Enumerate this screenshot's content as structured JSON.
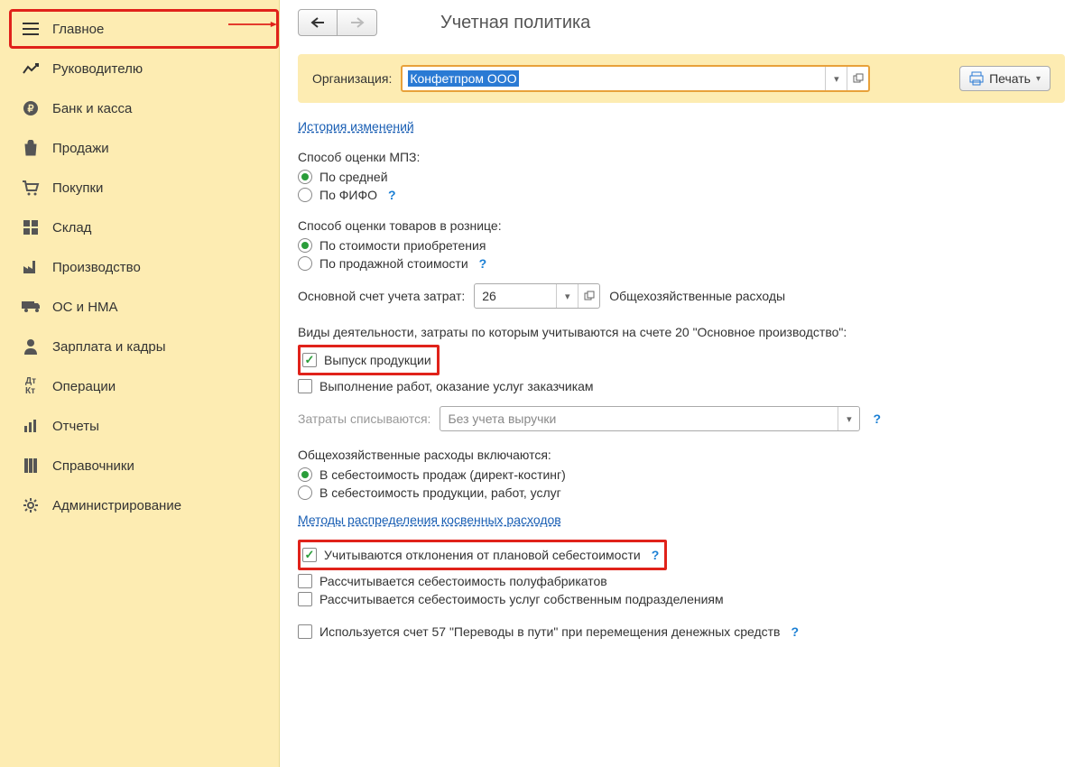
{
  "sidebar": {
    "items": [
      {
        "label": "Главное"
      },
      {
        "label": "Руководителю"
      },
      {
        "label": "Банк и касса"
      },
      {
        "label": "Продажи"
      },
      {
        "label": "Покупки"
      },
      {
        "label": "Склад"
      },
      {
        "label": "Производство"
      },
      {
        "label": "ОС и НМА"
      },
      {
        "label": "Зарплата и кадры"
      },
      {
        "label": "Операции"
      },
      {
        "label": "Отчеты"
      },
      {
        "label": "Справочники"
      },
      {
        "label": "Администрирование"
      }
    ]
  },
  "header": {
    "title": "Учетная политика",
    "print_label": "Печать"
  },
  "org": {
    "label": "Организация:",
    "value": "Конфетпром ООО"
  },
  "history_link": "История изменений",
  "mpz": {
    "label": "Способ оценки МПЗ:",
    "opt1": "По средней",
    "opt2": "По ФИФО"
  },
  "retail": {
    "label": "Способ оценки товаров в рознице:",
    "opt1": "По стоимости приобретения",
    "opt2": "По продажной стоимости"
  },
  "cost_account": {
    "label": "Основной счет учета затрат:",
    "value": "26",
    "hint": "Общехозяйственные расходы"
  },
  "activity": {
    "label": "Виды деятельности, затраты по которым учитываются на счете 20 \"Основное производство\":",
    "chk1": "Выпуск продукции",
    "chk2": "Выполнение работ, оказание услуг заказчикам"
  },
  "writeoff": {
    "label": "Затраты списываются:",
    "value": "Без учета выручки"
  },
  "overhead": {
    "label": "Общехозяйственные расходы включаются:",
    "opt1": "В себестоимость продаж (директ-костинг)",
    "opt2": "В  себестоимость продукции, работ, услуг"
  },
  "methods_link": "Методы распределения косвенных расходов",
  "checks_bottom": {
    "chk1": "Учитываются отклонения от плановой себестоимости",
    "chk2": "Рассчитывается себестоимость полуфабрикатов",
    "chk3": "Рассчитывается себестоимость услуг собственным подразделениям",
    "chk4": "Используется счет 57 \"Переводы в пути\" при перемещения денежных средств"
  }
}
